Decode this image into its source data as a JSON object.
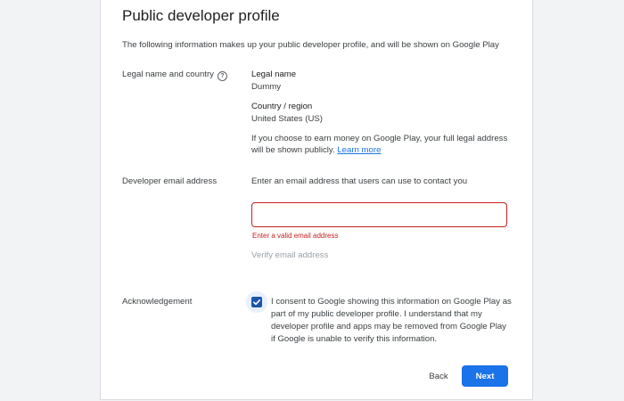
{
  "page": {
    "title": "Public developer profile",
    "intro": "The following information makes up your public developer profile, and will be shown on Google Play"
  },
  "legal": {
    "label": "Legal name and country",
    "help_icon": "?",
    "name_title": "Legal name",
    "name_value": "Dummy",
    "country_title": "Country / region",
    "country_value": "United States (US)",
    "note_text": "If you choose to earn money on Google Play, your full legal address will be shown publicly.",
    "learn_more": "Learn more"
  },
  "email": {
    "label": "Developer email address",
    "description": "Enter an email address that users can use to contact you",
    "value": "",
    "error": "Enter a valid email address",
    "verify": "Verify email address"
  },
  "acknowledgement": {
    "label": "Acknowledgement",
    "checked": true,
    "consent": "I consent to Google showing this information on Google Play as part of my public developer profile. I understand that my developer profile and apps may be removed from Google Play if Google is unable to verify this information."
  },
  "actions": {
    "back": "Back",
    "next": "Next"
  },
  "colors": {
    "accent": "#1a73e8",
    "error": "#c5221f",
    "checkbox": "#1a56a8"
  }
}
